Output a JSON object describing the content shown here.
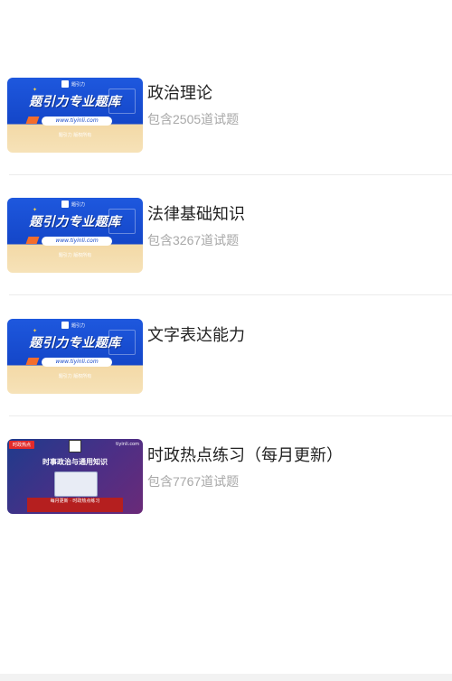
{
  "thumbnails": {
    "brand_headline": "题引力专业题库",
    "brand_url": "www.tiyinli.com",
    "brand_copyright": "题引力 版权所有",
    "brand_logo_text": "题引力",
    "news_tag": "时政热点",
    "news_site": "tiyinli.com",
    "news_headline": "时事政治与通用知识",
    "news_strip": "每月更新 · 时政热点练习"
  },
  "items": [
    {
      "title": "政治理论",
      "subtitle": "包含2505道试题"
    },
    {
      "title": "法律基础知识",
      "subtitle": "包含3267道试题"
    },
    {
      "title": "文字表达能力",
      "subtitle": ""
    },
    {
      "title": "时政热点练习（每月更新）",
      "subtitle": "包含7767道试题"
    }
  ]
}
